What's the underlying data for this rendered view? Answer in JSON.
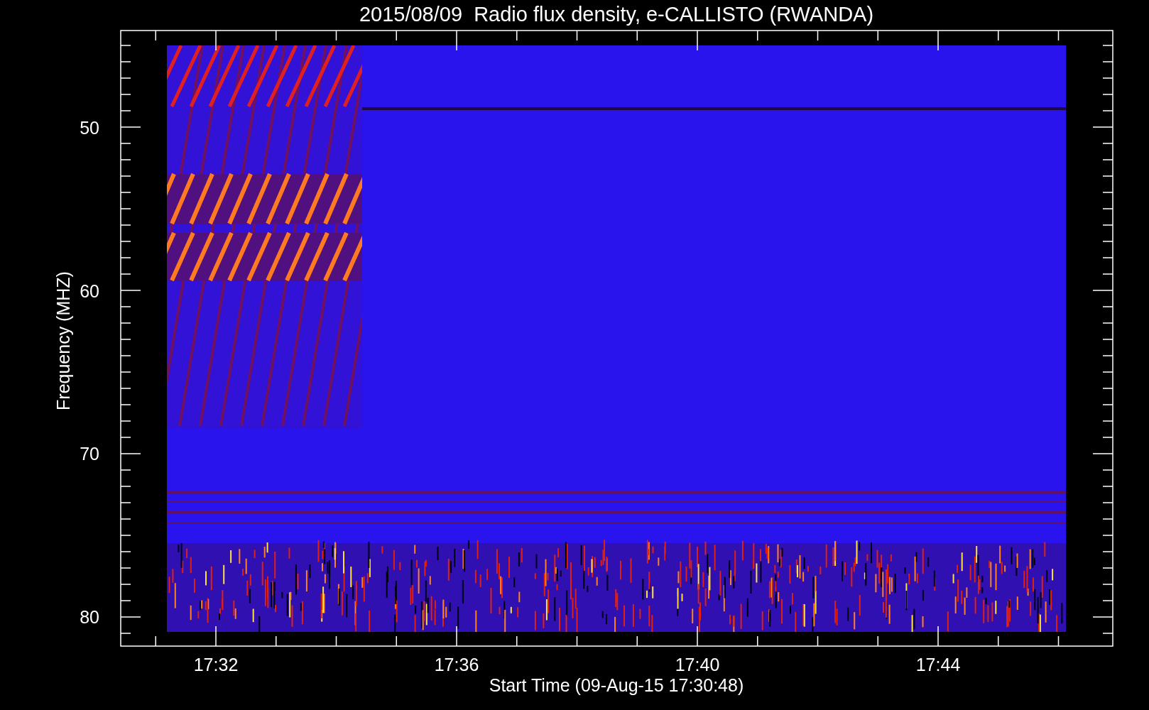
{
  "title": "2015/08/09  Radio flux density, e-CALLISTO (RWANDA)",
  "y_axis": {
    "label": "Frequency (MHZ)",
    "ticks": [
      "50",
      "60",
      "70",
      "80"
    ]
  },
  "x_axis": {
    "label": "Start Time (09-Aug-15 17:30:48)",
    "ticks": [
      "17:32",
      "17:36",
      "17:40",
      "17:44"
    ]
  }
}
